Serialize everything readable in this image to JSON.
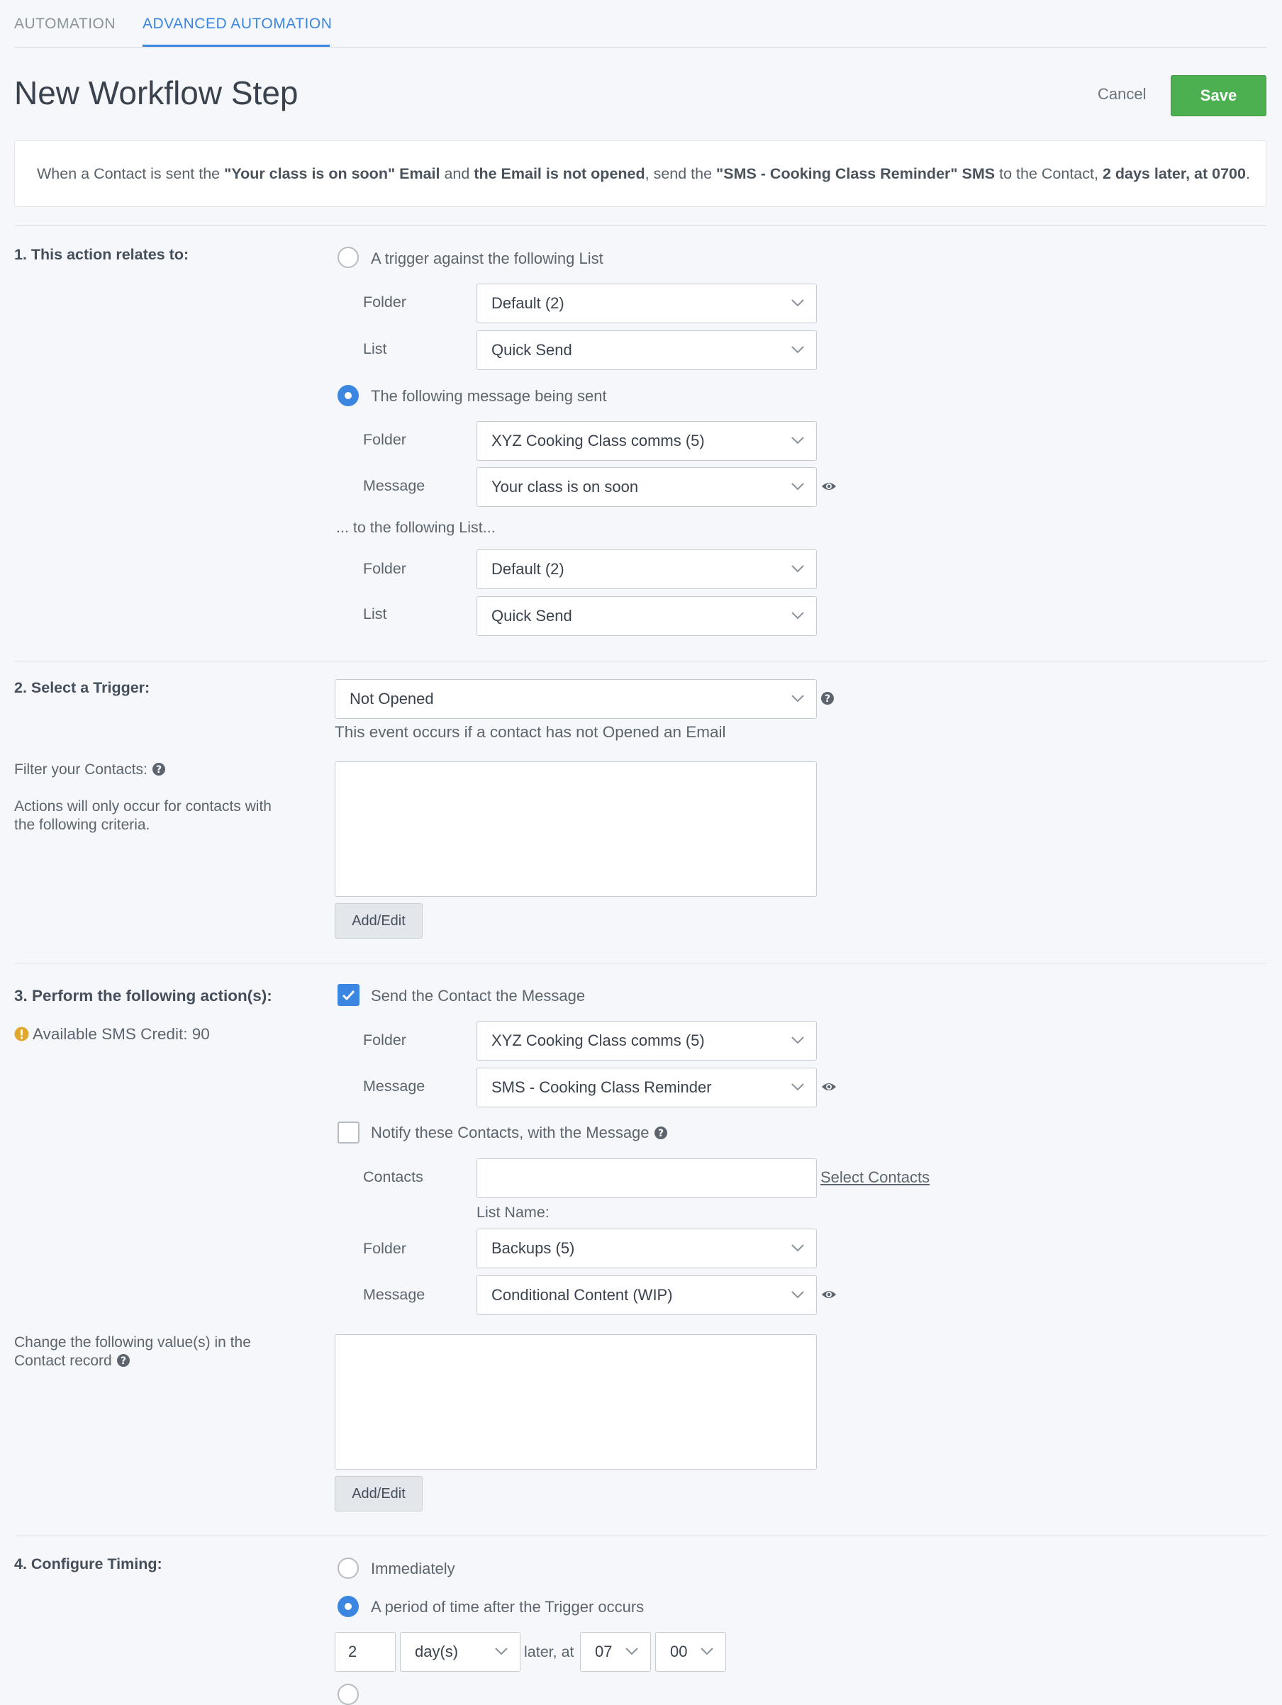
{
  "tabs": [
    {
      "label": "AUTOMATION",
      "active": false
    },
    {
      "label": "ADVANCED AUTOMATION",
      "active": true
    }
  ],
  "header": {
    "title": "New Workflow Step",
    "cancel_label": "Cancel",
    "save_label": "Save"
  },
  "summary": {
    "t1": "When a Contact is sent the ",
    "b1": "\"Your class is on soon\" Email",
    "t2": " and ",
    "b2": "the Email is not opened",
    "t3": ", send the ",
    "b3": "\"SMS - Cooking Class Reminder\" SMS",
    "t4": " to the Contact, ",
    "b4": "2 days later, at 0700",
    "t5": "."
  },
  "section1": {
    "label": "1. This action relates to:",
    "option_list": {
      "label": "A trigger against the following List",
      "selected": false
    },
    "list_folder": {
      "label": "Folder",
      "value": "Default (2)"
    },
    "list_list": {
      "label": "List",
      "value": "Quick Send"
    },
    "option_message": {
      "label": "The following message being sent",
      "selected": true
    },
    "msg_folder": {
      "label": "Folder",
      "value": "XYZ Cooking Class comms (5)"
    },
    "msg_message": {
      "label": "Message",
      "value": "Your class is on soon"
    },
    "to_list_label": "... to the following List...",
    "to_folder": {
      "label": "Folder",
      "value": "Default (2)"
    },
    "to_list": {
      "label": "List",
      "value": "Quick Send"
    }
  },
  "section2": {
    "label": "2. Select a Trigger:",
    "trigger": {
      "value": "Not Opened"
    },
    "trigger_hint": "This event occurs if a contact has not Opened an Email",
    "filter_label": "Filter your Contacts:",
    "filter_desc_1": "Actions will only occur for contacts with",
    "filter_desc_2": "the following criteria.",
    "add_edit": "Add/Edit"
  },
  "section3": {
    "label": "3. Perform the following action(s):",
    "credit": "Available SMS Credit: 90",
    "send_option": {
      "label": "Send the Contact the Message",
      "checked": true
    },
    "send_folder": {
      "label": "Folder",
      "value": "XYZ Cooking Class comms (5)"
    },
    "send_message": {
      "label": "Message",
      "value": "SMS - Cooking Class Reminder"
    },
    "notify_option": {
      "label": "Notify these Contacts, with the Message",
      "checked": false
    },
    "contacts": {
      "label": "Contacts",
      "value": "",
      "link": "Select Contacts"
    },
    "list_name_label": "List Name:",
    "notify_folder": {
      "label": "Folder",
      "value": "Backups (5)"
    },
    "notify_message": {
      "label": "Message",
      "value": "Conditional Content (WIP)"
    },
    "change_values_1": "Change the following value(s) in the",
    "change_values_2": "Contact record",
    "add_edit": "Add/Edit"
  },
  "section4": {
    "label": "4. Configure Timing:",
    "immediately": {
      "label": "Immediately",
      "selected": false
    },
    "period": {
      "label": "A period of time after the Trigger occurs",
      "selected": true
    },
    "amount": "2",
    "unit": "day(s)",
    "later_at": "later, at",
    "hour": "07",
    "minute": "00"
  },
  "colors": {
    "accent": "#3a86e0",
    "save": "#4caf50",
    "warning": "#e0a82e"
  }
}
